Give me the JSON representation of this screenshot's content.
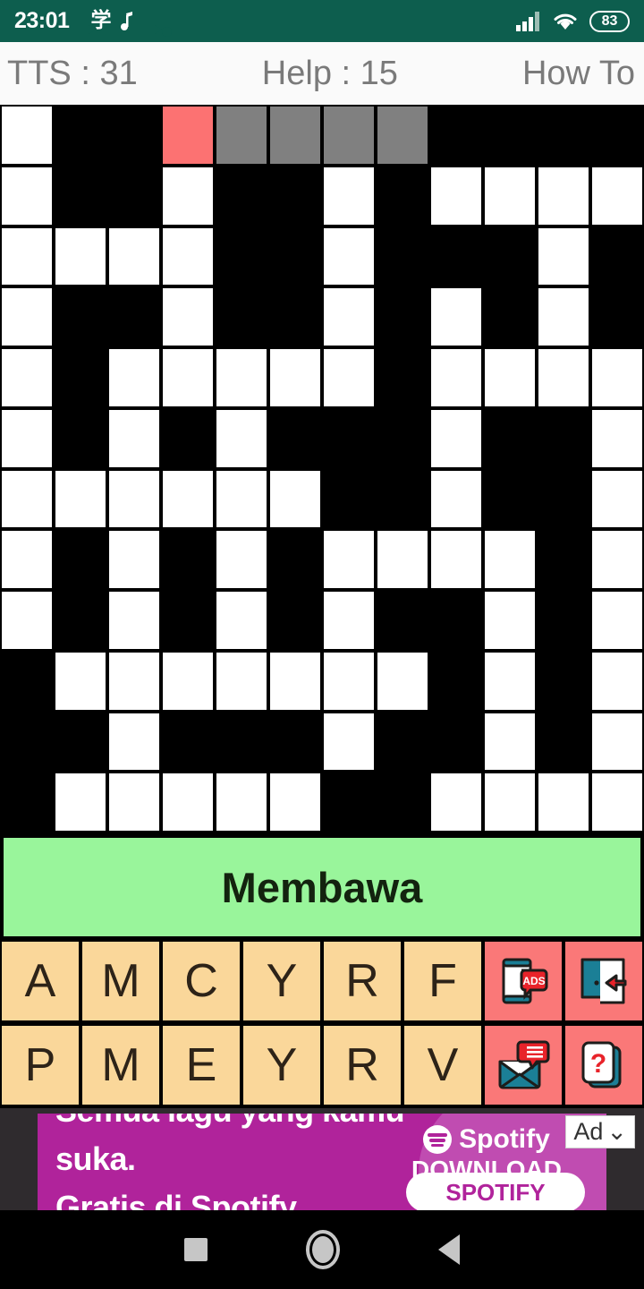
{
  "status_bar": {
    "time": "23:01",
    "battery_level": "83",
    "left_icons": [
      "youtube-icon",
      "translate-cjk-icon",
      "music-note-icon",
      "youtube-icon",
      "chrome-icon"
    ],
    "cjk_glyph": "学",
    "right_icons": [
      "signal-icon",
      "wifi-icon",
      "battery-icon"
    ],
    "background_color": "#0d5e4e"
  },
  "header": {
    "tts_label": "TTS : 31",
    "help_label": "Help : 15",
    "how_to_label": "How To"
  },
  "grid": {
    "rows": 12,
    "cols": 12,
    "cell_colors": {
      "white": "#ffffff",
      "black": "#000000",
      "gray": "#808080",
      "highlight": "#fc7272"
    },
    "cells": [
      [
        "white",
        "black",
        "black",
        "red",
        "gray",
        "gray",
        "gray",
        "gray",
        "black",
        "black",
        "black",
        "black"
      ],
      [
        "white",
        "black",
        "black",
        "white",
        "black",
        "black",
        "white",
        "black",
        "white",
        "white",
        "white",
        "white"
      ],
      [
        "white",
        "white",
        "white",
        "white",
        "black",
        "black",
        "white",
        "black",
        "black",
        "black",
        "white",
        "black"
      ],
      [
        "white",
        "black",
        "black",
        "white",
        "black",
        "black",
        "white",
        "black",
        "white",
        "black",
        "white",
        "black"
      ],
      [
        "white",
        "black",
        "white",
        "white",
        "white",
        "white",
        "white",
        "black",
        "white",
        "white",
        "white",
        "white"
      ],
      [
        "white",
        "black",
        "white",
        "black",
        "white",
        "black",
        "black",
        "black",
        "white",
        "black",
        "black",
        "white"
      ],
      [
        "white",
        "white",
        "white",
        "white",
        "white",
        "white",
        "black",
        "black",
        "white",
        "black",
        "black",
        "white"
      ],
      [
        "white",
        "black",
        "white",
        "black",
        "white",
        "black",
        "white",
        "white",
        "white",
        "white",
        "black",
        "white"
      ],
      [
        "white",
        "black",
        "white",
        "black",
        "white",
        "black",
        "white",
        "black",
        "black",
        "white",
        "black",
        "white"
      ],
      [
        "black",
        "white",
        "white",
        "white",
        "white",
        "white",
        "white",
        "white",
        "black",
        "white",
        "black",
        "white"
      ],
      [
        "black",
        "black",
        "white",
        "black",
        "black",
        "black",
        "white",
        "black",
        "black",
        "white",
        "black",
        "white"
      ],
      [
        "black",
        "white",
        "white",
        "white",
        "white",
        "white",
        "black",
        "black",
        "white",
        "white",
        "white",
        "white"
      ]
    ]
  },
  "clue": {
    "text": "Membawa",
    "background_color": "#99f59b"
  },
  "keyboard": {
    "tile_color": "#fad79a",
    "action_color": "#fa7878",
    "row1": [
      "A",
      "M",
      "C",
      "Y",
      "R",
      "F"
    ],
    "row2": [
      "P",
      "M",
      "E",
      "Y",
      "R",
      "V"
    ],
    "actions": [
      {
        "name": "watch-ads-button",
        "icon": "phone-ads-icon",
        "label": "ADS"
      },
      {
        "name": "exit-button",
        "icon": "exit-door-icon",
        "label": ""
      },
      {
        "name": "message-button",
        "icon": "envelope-message-icon",
        "label": ""
      },
      {
        "name": "hint-button",
        "icon": "question-card-icon",
        "label": "?"
      }
    ]
  },
  "ad": {
    "headline_line1": "Semua lagu yang kamu",
    "headline_line2": "suka.",
    "headline_line3": "Gratis di Spotify.",
    "brand": "Spotify",
    "download_label": "DOWNLOAD",
    "cta_label": "SPOTIFY",
    "badge_label": "Ad",
    "badge_caret": "⌄",
    "background_color": "#b0239b"
  },
  "nav_bar": {
    "buttons": [
      "recents-button",
      "home-button",
      "back-button"
    ]
  }
}
